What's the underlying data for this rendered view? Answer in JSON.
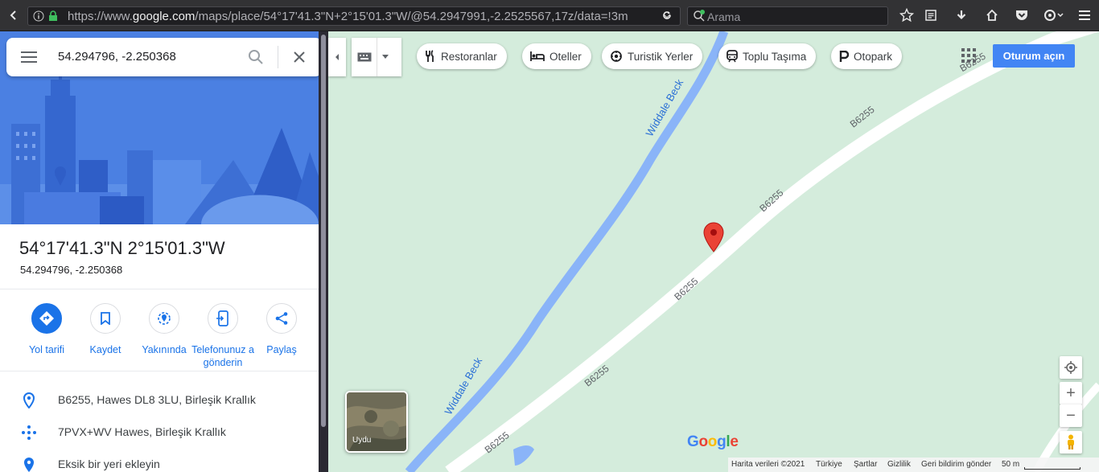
{
  "browser": {
    "url_prefix": "https://www.",
    "url_domain": "google.com",
    "url_rest": "/maps/place/54°17'41.3\"N+2°15'01.3\"W/@54.2947991,-2.2525567,17z/data=!3m",
    "search_placeholder": "Arama"
  },
  "panel": {
    "search_value": "54.294796, -2.250368",
    "title": "54°17'41.3\"N 2°15'01.3\"W",
    "subtitle": "54.294796, -2.250368",
    "actions": [
      {
        "label": "Yol tarifi"
      },
      {
        "label": "Kaydet"
      },
      {
        "label": "Yakınında"
      },
      {
        "label": "Telefonunuz a gönderin"
      },
      {
        "label": "Paylaş"
      }
    ],
    "info": [
      {
        "text": "B6255, Hawes DL8 3LU, Birleşik Krallık"
      },
      {
        "text": "7PVX+WV Hawes, Birleşik Krallık"
      },
      {
        "text": "Eksik bir yeri ekleyin"
      }
    ]
  },
  "map": {
    "chips": [
      {
        "label": "Restoranlar",
        "icon": "fork-knife-icon"
      },
      {
        "label": "Oteller",
        "icon": "bed-icon"
      },
      {
        "label": "Turistik Yerler",
        "icon": "camera-icon"
      },
      {
        "label": "Toplu Taşıma",
        "icon": "train-icon"
      },
      {
        "label": "Otopark",
        "icon": "parking-icon"
      }
    ],
    "signin_label": "Oturum açın",
    "road_labels": [
      "B6255",
      "B6255",
      "B6255",
      "B6255",
      "B6255",
      "B6255"
    ],
    "river_labels": [
      "Widdale Beck",
      "Widdale Beck"
    ],
    "satellite_label": "Uydu",
    "google_logo": "Google",
    "footer": {
      "data": "Harita verileri ©2021",
      "country": "Türkiye",
      "terms": "Şartlar",
      "privacy": "Gizlilik",
      "feedback": "Geri bildirim gönder",
      "scale": "50 m"
    },
    "zoom_in": "+",
    "zoom_out": "−"
  },
  "colors": {
    "map_bg": "#d4ecdc",
    "river": "#8ab4f8",
    "accent": "#1a73e8",
    "pin": "#ea4335"
  }
}
